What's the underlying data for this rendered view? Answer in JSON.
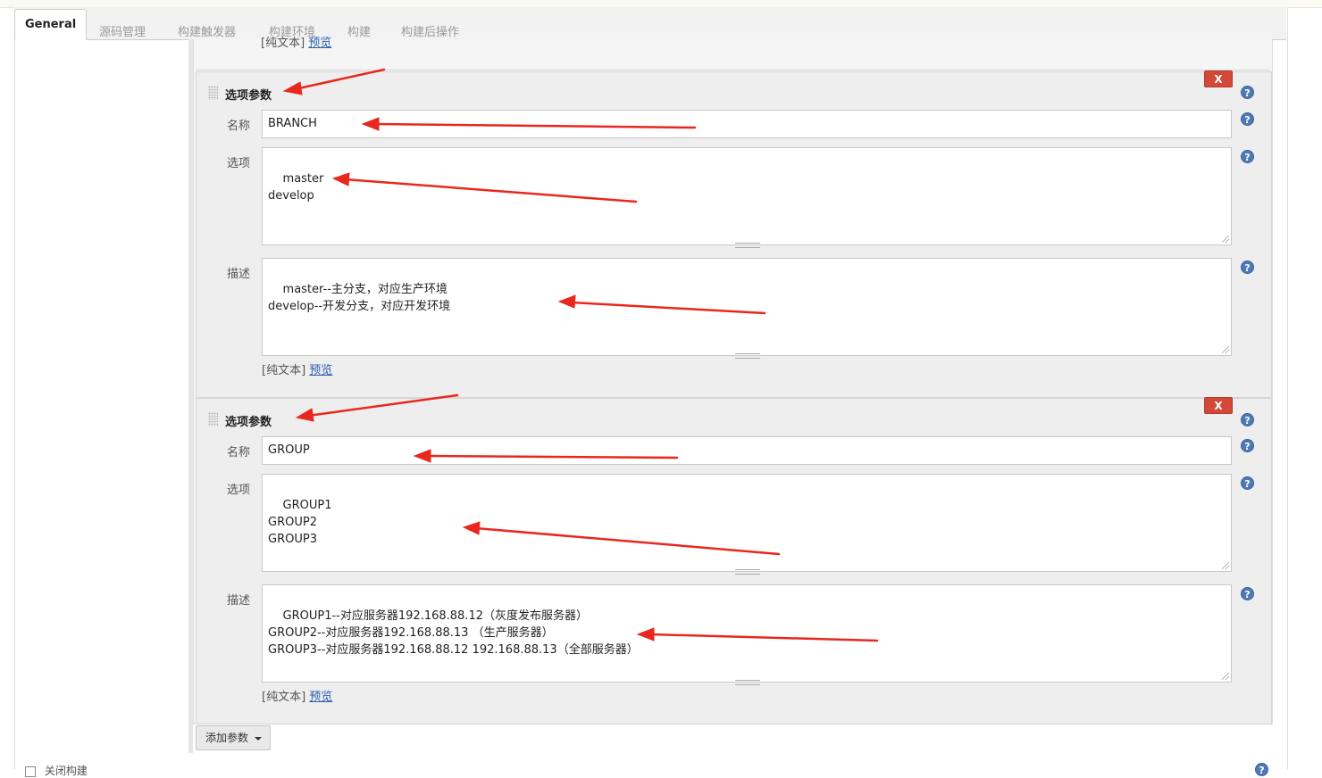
{
  "tabs": [
    "General",
    "源码管理",
    "构建触发器",
    "构建环境",
    "构建",
    "构建后操作"
  ],
  "top_fragment": {
    "plain": "[纯文本]",
    "preview": "预览"
  },
  "param1": {
    "title": "选项参数",
    "remove": "X",
    "help": "?",
    "name_label": "名称",
    "name_value": "BRANCH",
    "choices_label": "选项",
    "choices_value": "master\ndevelop",
    "desc_label": "描述",
    "desc_value": "master--主分支，对应生产环境\ndevelop--开发分支，对应开发环境",
    "plain": "[纯文本]",
    "preview": "预览"
  },
  "param2": {
    "title": "选项参数",
    "remove": "X",
    "help": "?",
    "name_label": "名称",
    "name_value": "GROUP",
    "choices_label": "选项",
    "choices_value": "GROUP1\nGROUP2\nGROUP3",
    "desc_label": "描述",
    "desc_value": "GROUP1--对应服务器192.168.88.12（灰度发布服务器）\nGROUP2--对应服务器192.168.88.13 （生产服务器）\nGROUP3--对应服务器192.168.88.12 192.168.88.13（全部服务器）",
    "plain": "[纯文本]",
    "preview": "预览"
  },
  "add_param": "添加参数",
  "bottom_checkbox": "关闭构建",
  "colors": {
    "remove_button": "#d24939",
    "help_icon": "#4e79b5",
    "link": "#2a5db0",
    "annotation_arrow": "#e8281e"
  }
}
